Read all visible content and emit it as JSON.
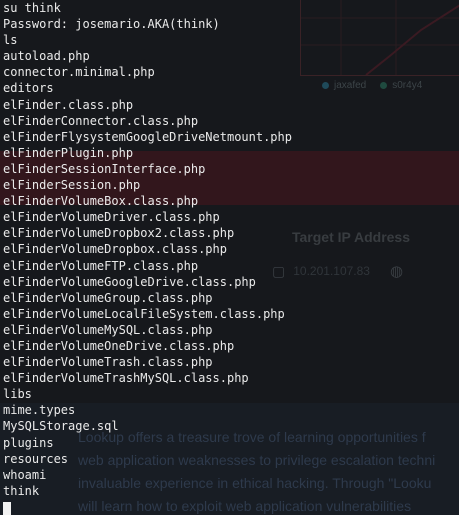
{
  "background": {
    "legend": [
      {
        "label": "jaxafed",
        "color": "#1f4a5a"
      },
      {
        "label": "s0r4y4",
        "color": "#1f4a3f"
      }
    ],
    "target_heading": "Target IP Address",
    "target_ip": "10.201.107.83",
    "paragraph_lines": [
      "Lookup offers a treasure trove of learning opportunities f",
      "web application weaknesses to privilege escalation techni",
      "invaluable experience in ethical hacking. Through \"Looku",
      "will learn how to exploit web application vulnerabilities"
    ]
  },
  "terminal": {
    "lines": [
      "su think",
      "Password: josemario.AKA(think)",
      "ls",
      "autoload.php",
      "connector.minimal.php",
      "editors",
      "elFinder.class.php",
      "elFinderConnector.class.php",
      "elFinderFlysystemGoogleDriveNetmount.php",
      "elFinderPlugin.php",
      "elFinderSessionInterface.php",
      "elFinderSession.php",
      "elFinderVolumeBox.class.php",
      "elFinderVolumeDriver.class.php",
      "elFinderVolumeDropbox2.class.php",
      "elFinderVolumeDropbox.class.php",
      "elFinderVolumeFTP.class.php",
      "elFinderVolumeGoogleDrive.class.php",
      "elFinderVolumeGroup.class.php",
      "elFinderVolumeLocalFileSystem.class.php",
      "elFinderVolumeMySQL.class.php",
      "elFinderVolumeOneDrive.class.php",
      "elFinderVolumeTrash.class.php",
      "elFinderVolumeTrashMySQL.class.php",
      "libs",
      "mime.types",
      "MySQLStorage.sql",
      "plugins",
      "resources",
      "whoami",
      "think"
    ]
  }
}
